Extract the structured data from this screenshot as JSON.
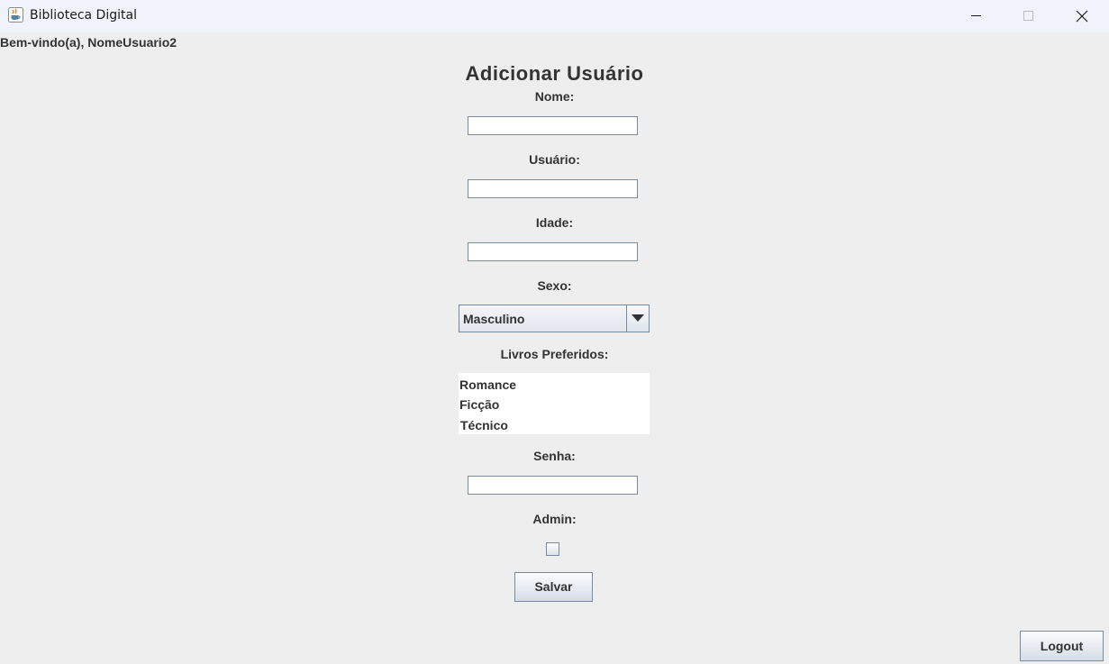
{
  "window": {
    "title": "Biblioteca Digital",
    "icon": "java-cup-icon"
  },
  "welcome": "Bem-vindo(a), NomeUsuario2",
  "form": {
    "title": "Adicionar Usuário",
    "nome_label": "Nome:",
    "nome_value": "",
    "usuario_label": "Usuário:",
    "usuario_value": "",
    "idade_label": "Idade:",
    "idade_value": "",
    "sexo_label": "Sexo:",
    "sexo_selected": "Masculino",
    "livros_label": "Livros Preferidos:",
    "livros_options": [
      "Romance",
      "Ficção",
      "Técnico"
    ],
    "senha_label": "Senha:",
    "senha_value": "",
    "admin_label": "Admin:",
    "admin_checked": false,
    "save_label": "Salvar"
  },
  "logout_label": "Logout"
}
